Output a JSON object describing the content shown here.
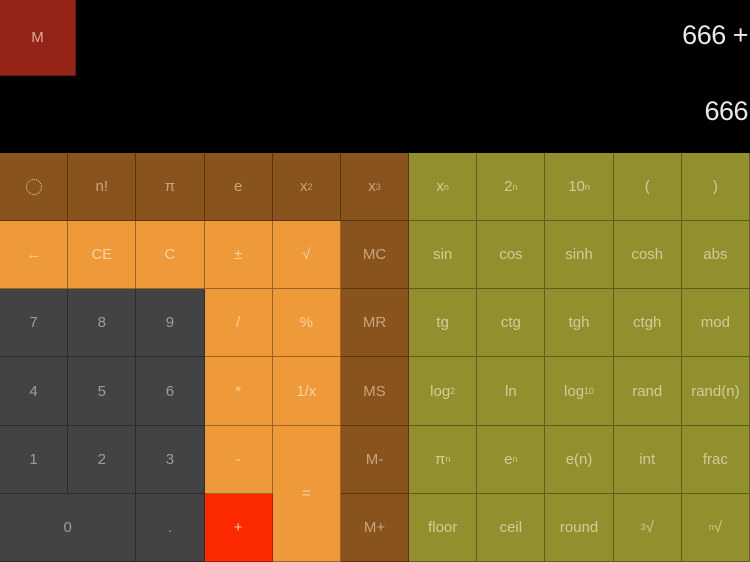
{
  "display": {
    "memory_indicator": "M",
    "expression": "666 +",
    "result": "666"
  },
  "colors": {
    "display_bg": "#000000",
    "memory_indicator_bg": "#942516",
    "function_brown": "#88531d",
    "operator_orange": "#ef9a3a",
    "digit_gray": "#434343",
    "scientific_olive": "#928f2f",
    "active_operator_red": "#fd2a00"
  },
  "keys": {
    "settings_icon": "settings-circle-icon",
    "factorial": "n!",
    "pi": "π",
    "e": "e",
    "x_squared": {
      "base": "x",
      "sup": "2"
    },
    "x_cubed": {
      "base": "x",
      "sup": "3"
    },
    "x_pow_n": {
      "base": "x",
      "sup": "n"
    },
    "two_pow_n": {
      "base": "2",
      "sup": "n"
    },
    "ten_pow_n": {
      "base": "10",
      "sup": "n"
    },
    "open_paren": "(",
    "close_paren": ")",
    "backspace": "←",
    "ce": "CE",
    "c": "C",
    "plus_minus": "±",
    "sqrt": "√",
    "mc": "MC",
    "sin": "sin",
    "cos": "cos",
    "sinh": "sinh",
    "cosh": "cosh",
    "abs": "abs",
    "seven": "7",
    "eight": "8",
    "nine": "9",
    "divide": "/",
    "percent": "%",
    "mr": "MR",
    "tg": "tg",
    "ctg": "ctg",
    "tgh": "tgh",
    "ctgh": "ctgh",
    "mod": "mod",
    "four": "4",
    "five": "5",
    "six": "6",
    "multiply": "*",
    "reciprocal": "1/x",
    "ms": "MS",
    "log2": {
      "base": "log",
      "sub": "2"
    },
    "ln": "ln",
    "log10": {
      "base": "log",
      "sub": "10"
    },
    "rand": "rand",
    "rand_n": "rand(n)",
    "one": "1",
    "two": "2",
    "three": "3",
    "minus": "-",
    "equals": "=",
    "m_minus": "M-",
    "pi_pow_n": {
      "base": "π",
      "sup": "n"
    },
    "e_pow_n": {
      "base": "e",
      "sup": "n"
    },
    "e_n": "e(n)",
    "int": "int",
    "frac": "frac",
    "zero": "0",
    "decimal": ".",
    "plus": "+",
    "m_plus": "M+",
    "floor": "floor",
    "ceil": "ceil",
    "round": "round",
    "cube_root": {
      "sup": "3",
      "base": "√"
    },
    "nth_root": {
      "sup": "n",
      "base": "√"
    }
  }
}
